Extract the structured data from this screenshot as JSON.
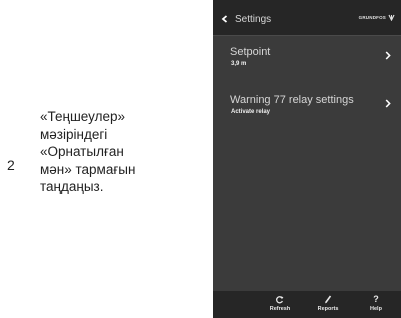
{
  "step": {
    "number": "2"
  },
  "instruction": {
    "lines": [
      "«Теңшеулер»",
      "мәзіріндегі",
      "«Орнатылған",
      "мән» тармағын",
      "таңдаңыз."
    ]
  },
  "phone": {
    "topbar": {
      "title": "Settings",
      "back_icon": "chevron-left-icon",
      "brand": "GRUNDFOS"
    },
    "menu": [
      {
        "title": "Setpoint",
        "value": "3,9 m",
        "icon": "chevron-right-icon"
      },
      {
        "title": "Warning 77 relay settings",
        "value": "Activate relay",
        "icon": "chevron-right-icon"
      }
    ],
    "bottombar": {
      "refresh": {
        "label": "Refresh",
        "icon": "refresh-icon"
      },
      "reports": {
        "label": "Reports",
        "icon": "pencil-icon"
      },
      "help": {
        "label": "Help",
        "glyph": "?",
        "icon": "help-icon"
      }
    }
  },
  "colors": {
    "screen_bg": "#3b3b3b",
    "bar_bg": "#262626",
    "text_light": "#d6d6d6"
  }
}
